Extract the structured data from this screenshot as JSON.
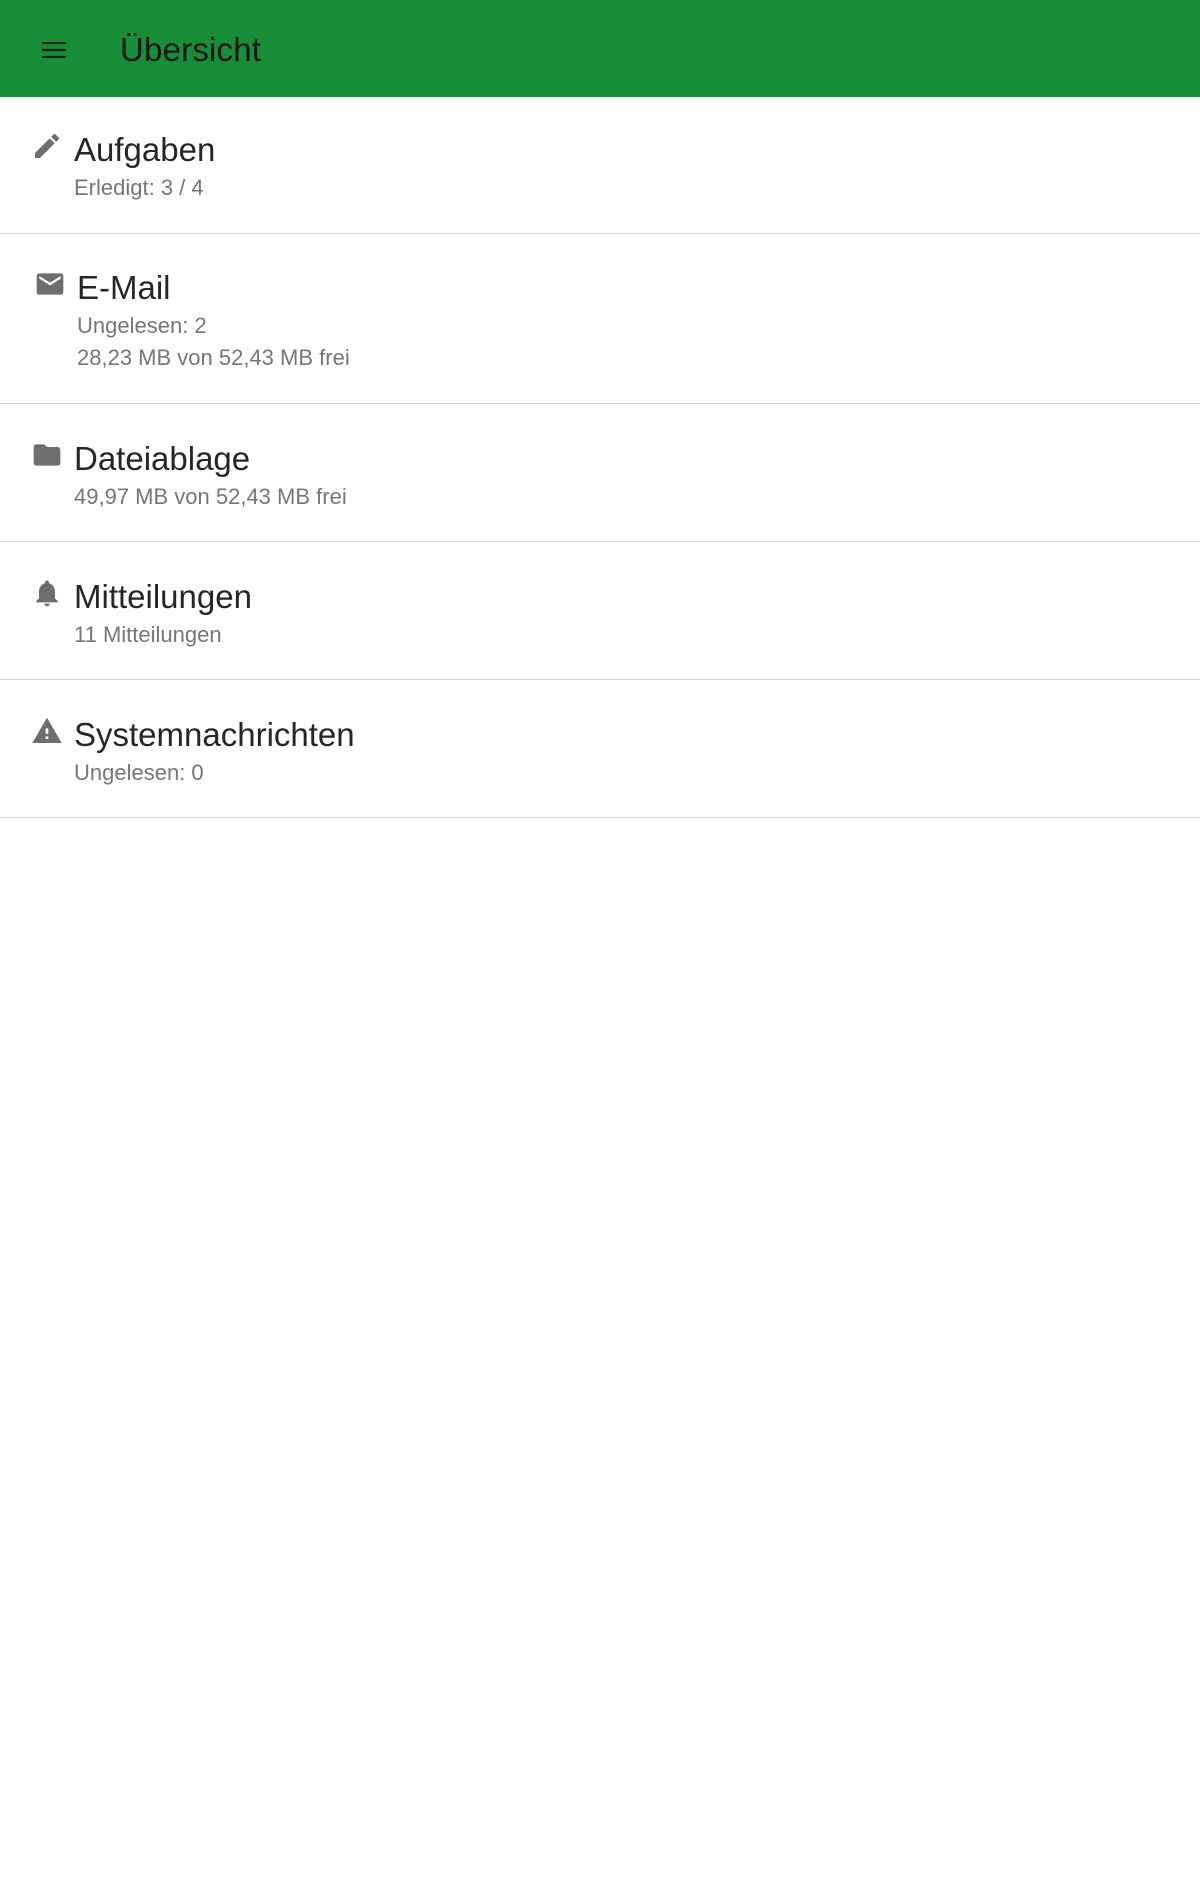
{
  "colors": {
    "app_bar": "#188d38",
    "title_text": "#141414",
    "item_title": "#262626",
    "item_subtitle": "#767676",
    "icon": "#6e6e6e",
    "divider": "#d4d4d4"
  },
  "header": {
    "menu_icon": "menu-icon",
    "title": "Übersicht"
  },
  "items": [
    {
      "icon": "pencil-icon",
      "title": "Aufgaben",
      "lines": [
        "Erledigt: 3 / 4"
      ]
    },
    {
      "icon": "mail-icon",
      "title": "E-Mail",
      "lines": [
        "Ungelesen: 2",
        "28,23 MB von 52,43 MB frei"
      ]
    },
    {
      "icon": "folder-icon",
      "title": "Dateiablage",
      "lines": [
        "49,97 MB von 52,43 MB frei"
      ]
    },
    {
      "icon": "bell-icon",
      "title": "Mitteilungen",
      "lines": [
        "11 Mitteilungen"
      ]
    },
    {
      "icon": "warning-icon",
      "title": "Systemnachrichten",
      "lines": [
        "Ungelesen: 0"
      ]
    }
  ]
}
